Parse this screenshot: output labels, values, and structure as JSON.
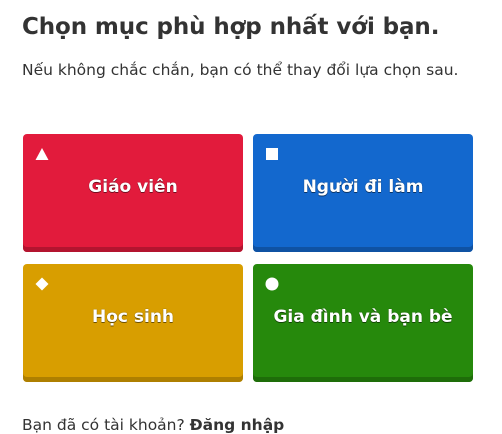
{
  "heading": "Chọn mục phù hợp nhất với bạn.",
  "subheading": "Nếu không chắc chắn, bạn có thể thay đổi lựa chọn sau.",
  "options": [
    {
      "label": "Giáo viên",
      "icon": "triangle-icon",
      "color": "#e21b3c"
    },
    {
      "label": "Người đi làm",
      "icon": "square-icon",
      "color": "#1368ce"
    },
    {
      "label": "Học sinh",
      "icon": "diamond-icon",
      "color": "#d89e00"
    },
    {
      "label": "Gia đình và bạn bè",
      "icon": "circle-icon",
      "color": "#26890c"
    }
  ],
  "footer": {
    "text": "Bạn đã có tài khoản?",
    "link": "Đăng nhập"
  }
}
